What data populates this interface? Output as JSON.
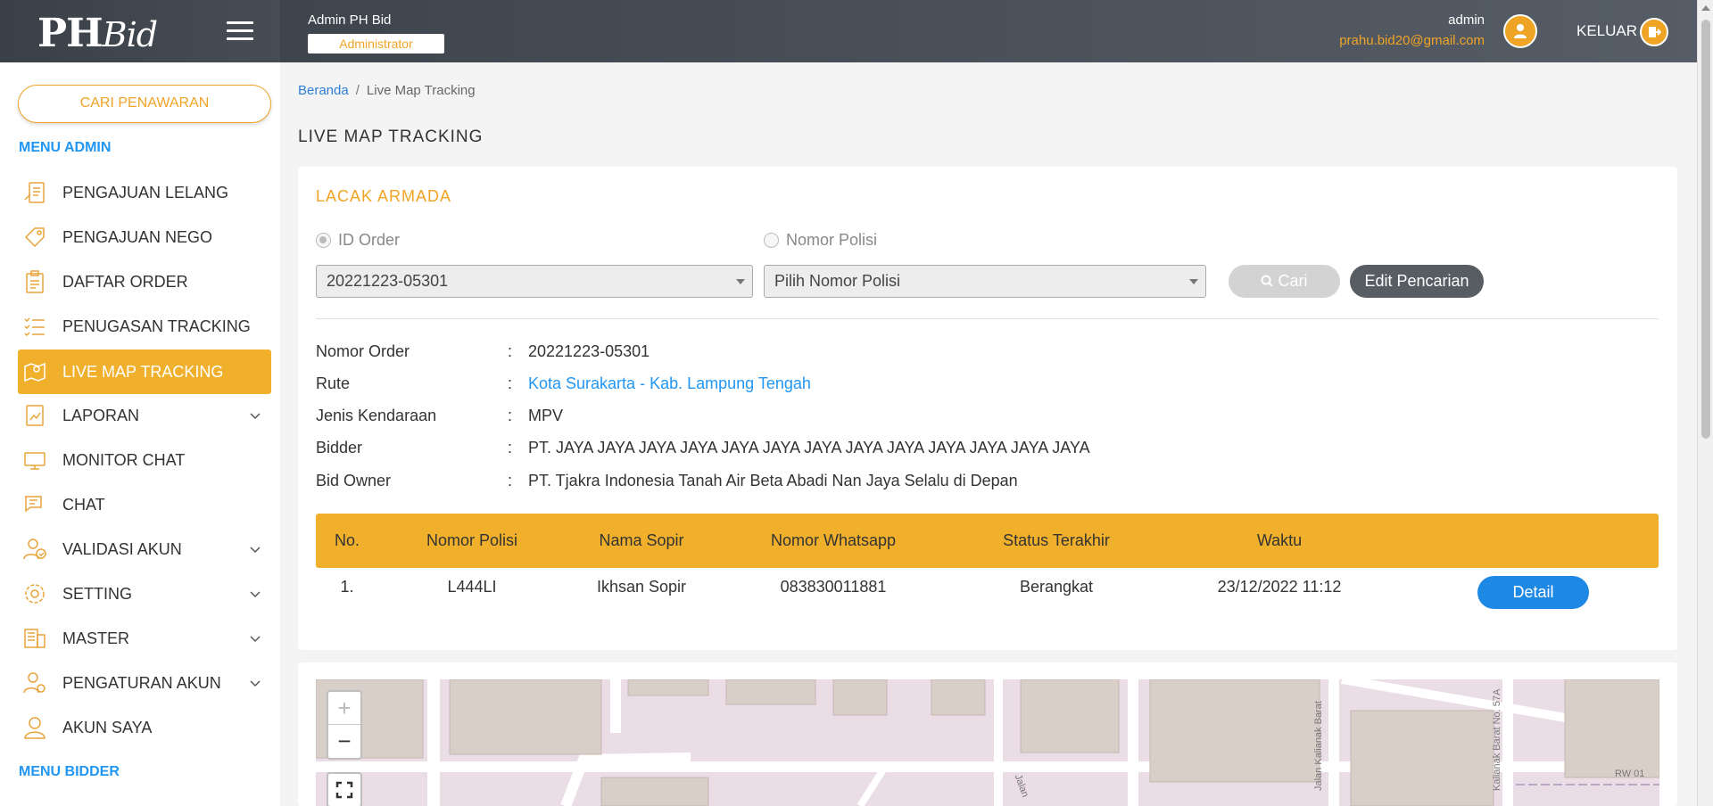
{
  "header": {
    "logo_main": "PH",
    "logo_script": "Bid",
    "user_name": "Admin PH Bid",
    "role": "Administrator",
    "account_name": "admin",
    "account_email": "prahu.bid20@gmail.com",
    "logout_label": "KELUAR"
  },
  "sidebar": {
    "search_label": "CARI PENAWARAN",
    "admin_heading": "MENU ADMIN",
    "bidder_heading": "MENU BIDDER",
    "items": [
      {
        "label": "PENGAJUAN LELANG",
        "icon": "auction-icon"
      },
      {
        "label": "PENGAJUAN NEGO",
        "icon": "tag-icon"
      },
      {
        "label": "DAFTAR ORDER",
        "icon": "clipboard-icon"
      },
      {
        "label": "PENUGASAN TRACKING",
        "icon": "checklist-icon"
      },
      {
        "label": "LIVE MAP TRACKING",
        "icon": "map-pin-icon"
      },
      {
        "label": "LAPORAN",
        "icon": "report-icon"
      },
      {
        "label": "MONITOR CHAT",
        "icon": "monitor-chat-icon"
      },
      {
        "label": "CHAT",
        "icon": "chat-icon"
      },
      {
        "label": "VALIDASI AKUN",
        "icon": "user-check-icon"
      },
      {
        "label": "SETTING",
        "icon": "gear-icon"
      },
      {
        "label": "MASTER",
        "icon": "database-icon"
      },
      {
        "label": "PENGATURAN AKUN",
        "icon": "user-gear-icon"
      },
      {
        "label": "AKUN SAYA",
        "icon": "user-icon"
      }
    ]
  },
  "breadcrumb": {
    "home": "Beranda",
    "sep": "/",
    "current": "Live Map Tracking"
  },
  "page_title": "LIVE MAP TRACKING",
  "tracker": {
    "title": "LACAK ARMADA",
    "radio_order": "ID Order",
    "radio_plate": "Nomor Polisi",
    "order_select": "20221223-05301",
    "plate_select": "Pilih Nomor Polisi",
    "search_label": "Cari",
    "edit_label": "Edit Pencarian"
  },
  "info": {
    "colon": ":",
    "rows": [
      {
        "key": "Nomor Order",
        "value": "20221223-05301"
      },
      {
        "key": "Rute",
        "value": "Kota Surakarta - Kab. Lampung Tengah"
      },
      {
        "key": "Jenis Kendaraan",
        "value": "MPV"
      },
      {
        "key": "Bidder",
        "value": "PT. JAYA JAYA JAYA JAYA JAYA JAYA JAYA JAYA JAYA JAYA JAYA JAYA JAYA"
      },
      {
        "key": "Bid Owner",
        "value": "PT. Tjakra Indonesia Tanah Air Beta Abadi Nan Jaya Selalu di Depan"
      }
    ]
  },
  "table": {
    "headers": [
      "No.",
      "Nomor Polisi",
      "Nama Sopir",
      "Nomor Whatsapp",
      "Status Terakhir",
      "Waktu"
    ],
    "rows": [
      {
        "no": "1.",
        "plate": "L444LI",
        "driver": "Ikhsan Sopir",
        "whatsapp": "083830011881",
        "status": "Berangkat",
        "time": "23/12/2022 11:12",
        "action": "Detail"
      }
    ]
  },
  "map": {
    "zoom_in": "+",
    "zoom_out": "−",
    "street_1": "Jalan Kalianak Barat",
    "street_2": "Kalianak Barat No. 57A",
    "street_3": "Jalan",
    "area_label": "RW 01"
  }
}
